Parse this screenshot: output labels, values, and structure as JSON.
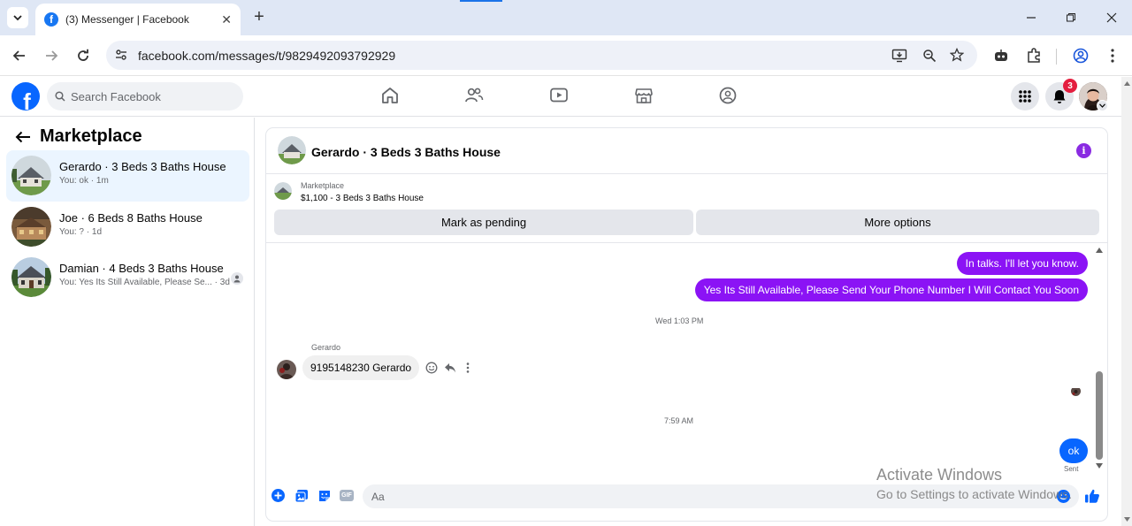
{
  "browser": {
    "tab_title": "(3) Messenger | Facebook",
    "url": "facebook.com/messages/t/9829492093792929"
  },
  "header": {
    "search_placeholder": "Search Facebook",
    "notifications_count": "3"
  },
  "sidebar": {
    "title": "Marketplace",
    "conversations": [
      {
        "name": "Gerardo · 3 Beds 3 Baths House",
        "preview": "You: ok · 1m",
        "active": true
      },
      {
        "name": "Joe · 6 Beds 8 Baths House",
        "preview": "You: ? · 1d",
        "active": false
      },
      {
        "name": "Damian · 4 Beds 3 Baths House",
        "preview": "You: Yes Its Still Available, Please Se... · 3d",
        "active": false
      }
    ]
  },
  "chat": {
    "title": "Gerardo · 3 Beds 3 Baths House",
    "marketplace_label": "Marketplace",
    "listing": "$1,100 - 3 Beds 3 Baths House",
    "mark_pending_label": "Mark as pending",
    "more_options_label": "More options",
    "messages": {
      "out1": "In talks. I'll let you know.",
      "out2": "Yes Its Still Available, Please Send Your Phone Number I Will Contact You Soon",
      "stamp1": "Wed 1:03 PM",
      "sender": "Gerardo",
      "in1": "9195148230 Gerardo",
      "stamp2": "7:59 AM",
      "out3": "ok",
      "status": "Sent"
    },
    "composer_placeholder": "Aa"
  },
  "watermark": {
    "line1": "Activate Windows",
    "line2": "Go to Settings to activate Windows."
  },
  "colors": {
    "accent": "#0866ff",
    "outgoing_bubble": "#8b13f5",
    "active_conv": "#ebf5ff"
  }
}
